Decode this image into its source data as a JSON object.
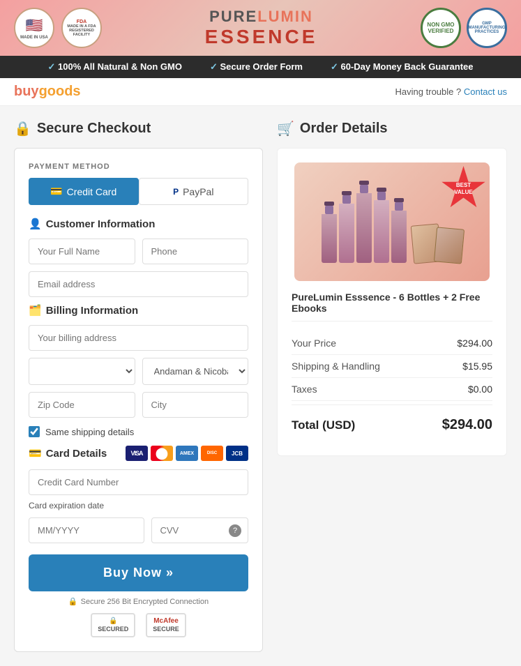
{
  "header": {
    "brand_pure": "PURE",
    "brand_lumin": "LUMIN",
    "brand_essence": "ESSENCE",
    "badge_usa": "MADE IN\nUSA",
    "badge_fda": "MADE IN A\nFDA\nREGISTERED\nFACILITY",
    "badge_nongmo": "NON\nGMO\nVERIFIED",
    "badge_gmp": "GMP\nMANUFACTURING\nPRACTICES"
  },
  "trust_bar": {
    "item1": "100% All Natural & Non GMO",
    "item2": "Secure Order Form",
    "item3": "60-Day Money Back Guarantee"
  },
  "nav": {
    "logo": "buygoods",
    "trouble_text": "Having trouble ?",
    "contact_link": "Contact us"
  },
  "checkout": {
    "title": "Secure Checkout",
    "payment_method_label": "PAYMENT METHOD",
    "tab_credit": "Credit Card",
    "tab_paypal": "PayPal",
    "customer_section": "Customer Information",
    "full_name_placeholder": "Your Full Name",
    "phone_placeholder": "Phone",
    "email_placeholder": "Email address",
    "billing_section": "Billing Information",
    "billing_address_placeholder": "Your billing address",
    "country_placeholder": "",
    "state_default": "Andaman & Nicobar",
    "zip_placeholder": "Zip Code",
    "city_placeholder": "City",
    "same_shipping_label": "Same shipping details",
    "card_details_section": "Card Details",
    "card_number_placeholder": "Credit Card Number",
    "expiry_label": "Card expiration date",
    "expiry_placeholder": "MM/YYYY",
    "cvv_placeholder": "CVV",
    "buy_button": "Buy Now »",
    "secure_note": "Secure 256 Bit Encrypted Connection",
    "secured_badge": "SECURED",
    "mcafee_badge": "McAfee\nSECURE"
  },
  "order": {
    "title": "Order Details",
    "product_name": "PureLumin Esssence - 6 Bottles + 2 Free Ebooks",
    "best_value": "BEST\nVALUE",
    "your_price_label": "Your Price",
    "your_price_value": "$294.00",
    "shipping_label": "Shipping & Handling",
    "shipping_value": "$15.95",
    "taxes_label": "Taxes",
    "taxes_value": "$0.00",
    "total_label": "Total (USD)",
    "total_value": "$294.00"
  }
}
